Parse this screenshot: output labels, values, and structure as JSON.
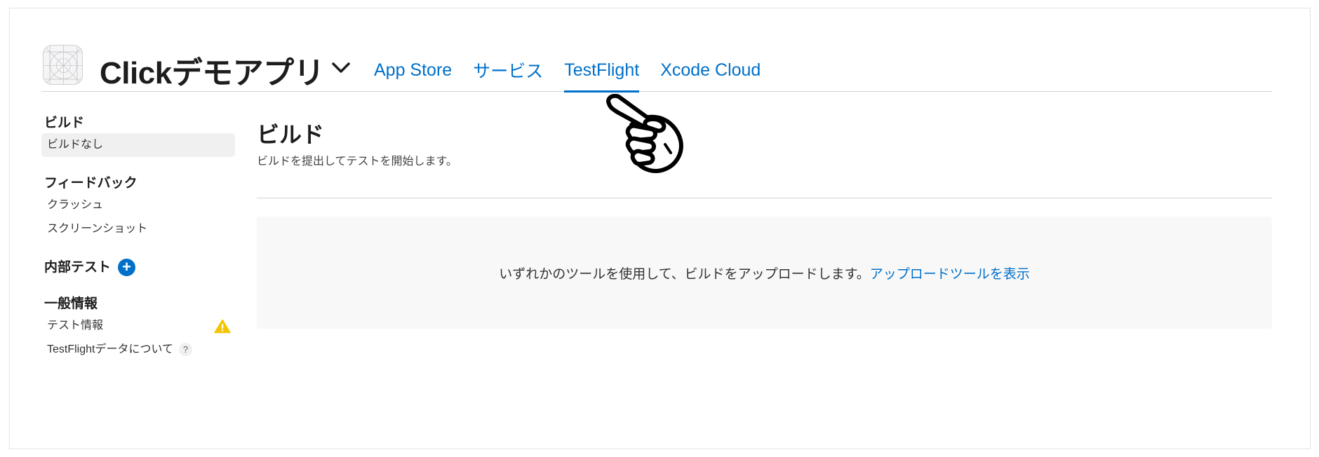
{
  "header": {
    "app_name": "Clickデモアプリ",
    "tabs": [
      {
        "label": "App Store",
        "active": false
      },
      {
        "label": "サービス",
        "active": false
      },
      {
        "label": "TestFlight",
        "active": true
      },
      {
        "label": "Xcode Cloud",
        "active": false
      }
    ]
  },
  "sidebar": {
    "builds": {
      "title": "ビルド",
      "items": [
        {
          "label": "ビルドなし",
          "selected": true
        }
      ]
    },
    "feedback": {
      "title": "フィードバック",
      "items": [
        {
          "label": "クラッシュ"
        },
        {
          "label": "スクリーンショット"
        }
      ]
    },
    "internal_testing": {
      "title": "内部テスト",
      "add_icon": "plus-circle-icon",
      "add_symbol": "+"
    },
    "general_info": {
      "title": "一般情報",
      "items": [
        {
          "label": "テスト情報",
          "icon": "warning-icon"
        },
        {
          "label": "TestFlightデータについて",
          "icon": "help-icon",
          "icon_text": "?"
        }
      ]
    }
  },
  "main": {
    "title": "ビルド",
    "subtitle": "ビルドを提出してテストを開始します。",
    "empty_message": "いずれかのツールを使用して、ビルドをアップロードします。",
    "empty_link": "アップロードツールを表示"
  },
  "colors": {
    "accent": "#0070c9",
    "warning": "#f5c400",
    "divider": "#d2d2d7",
    "panel_bg": "#f8f8f8",
    "selected_bg": "#f0f0f0"
  },
  "overlay": {
    "icon": "pointing-hand-icon"
  }
}
